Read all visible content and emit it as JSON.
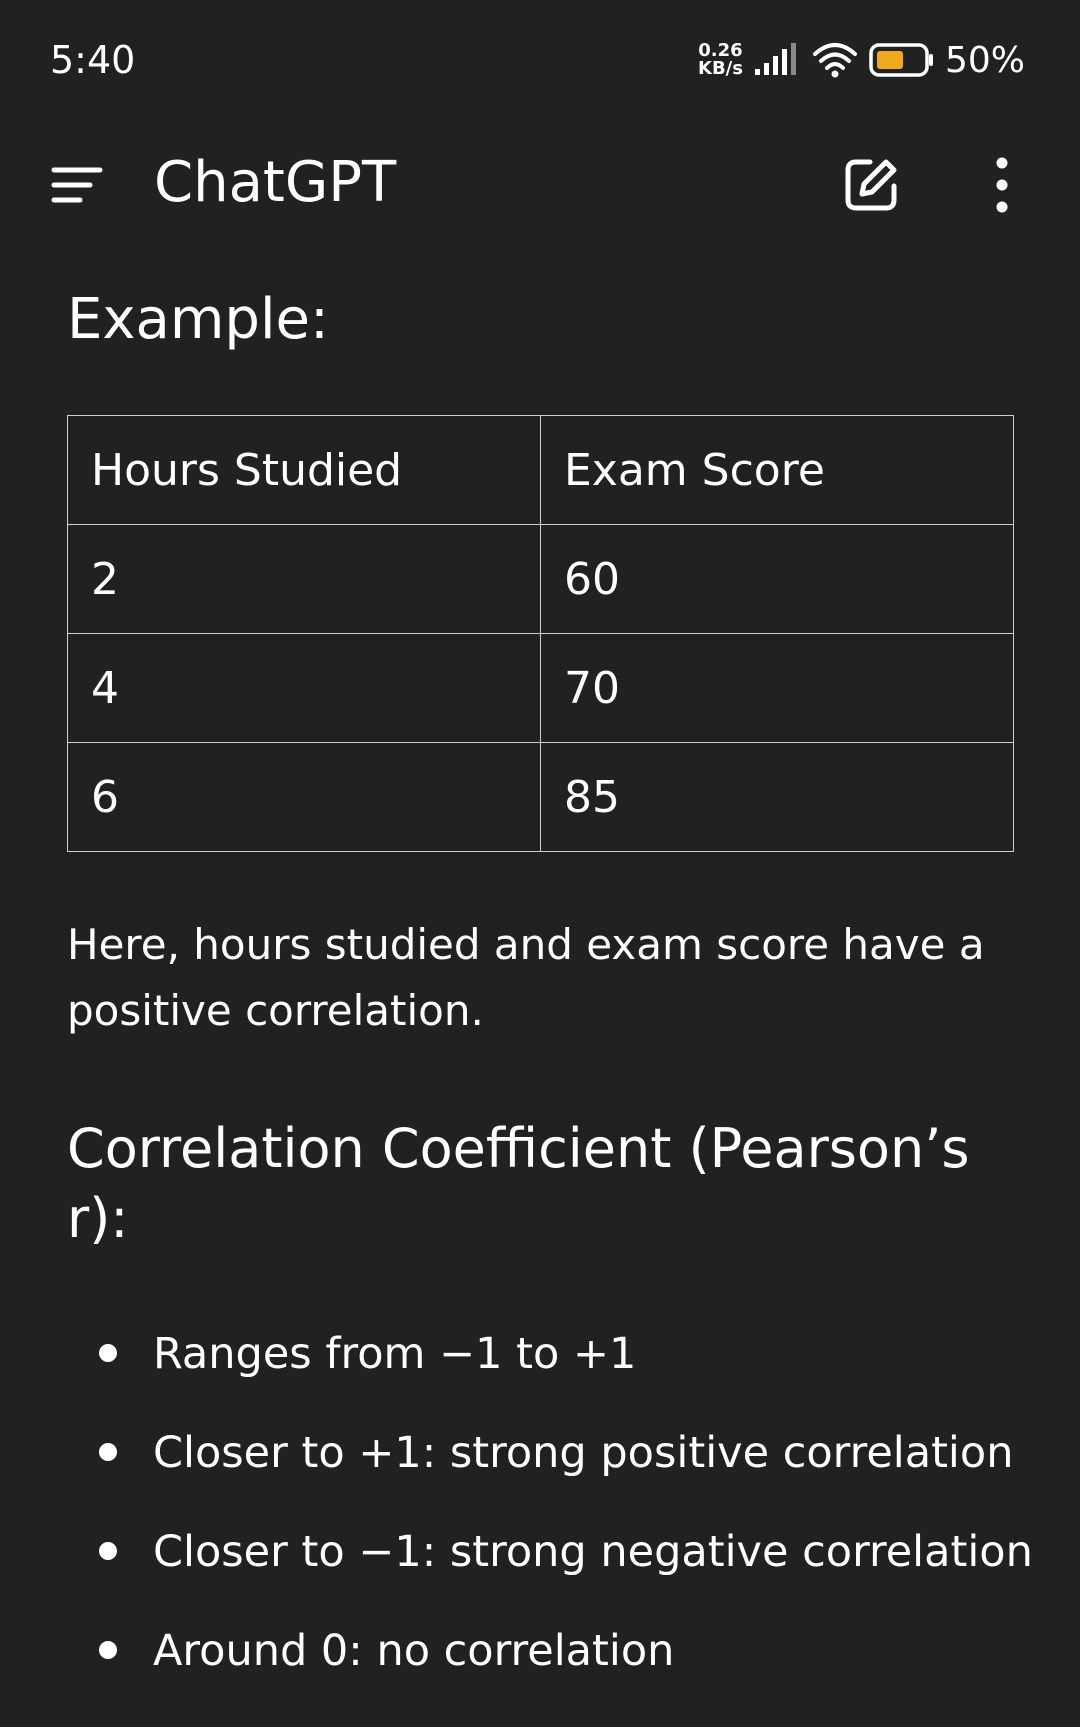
{
  "status_bar": {
    "time": "5:40",
    "net_speed_value": "0.26",
    "net_speed_unit": "KB/s",
    "battery_percent": "50%",
    "battery_color": "#f0a81c"
  },
  "app_bar": {
    "title": "ChatGPT",
    "menu_icon": "hamburger-menu-icon",
    "edit_icon": "new-chat-edit-icon",
    "more_icon": "more-vertical-icon"
  },
  "content": {
    "example_heading": "Example:",
    "table": {
      "headers": [
        "Hours Studied",
        "Exam Score"
      ],
      "rows": [
        [
          "2",
          "60"
        ],
        [
          "4",
          "70"
        ],
        [
          "6",
          "85"
        ]
      ]
    },
    "paragraph": "Here, hours studied and exam score have a positive correlation.",
    "correlation_heading": "Correlation Coefficient (Pearson’s r):",
    "bullets": [
      "Ranges from −1 to +1",
      "Closer to +1: strong positive correlation",
      "Closer to −1: strong negative correlation",
      "Around 0: no correlation"
    ]
  }
}
